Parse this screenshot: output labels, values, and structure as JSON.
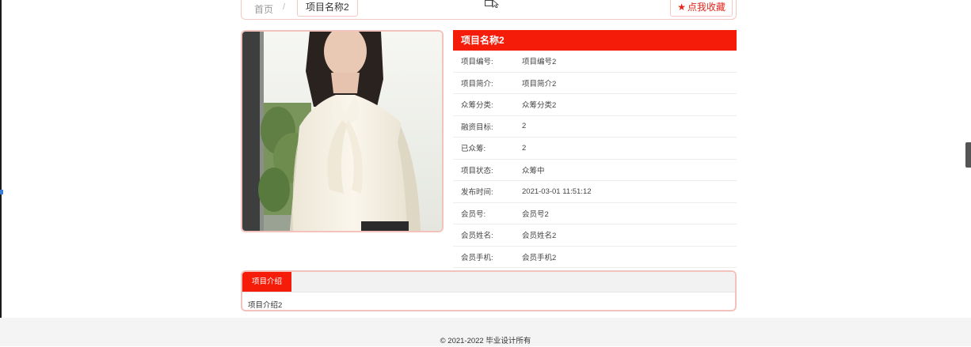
{
  "breadcrumb": {
    "home": "首页",
    "separator": "/",
    "current": "项目名称2"
  },
  "favorite_button": {
    "icon": "star-icon",
    "label": "点我收藏"
  },
  "project": {
    "title": "项目名称2",
    "fields": [
      {
        "label": "项目编号:",
        "value": "项目编号2"
      },
      {
        "label": "项目简介:",
        "value": "项目简介2"
      },
      {
        "label": "众筹分类:",
        "value": "众筹分类2"
      },
      {
        "label": "融资目标:",
        "value": "2"
      },
      {
        "label": "已众筹:",
        "value": "2"
      },
      {
        "label": "项目状态:",
        "value": "众筹中"
      },
      {
        "label": "发布时间:",
        "value": "2021-03-01 11:51:12"
      },
      {
        "label": "会员号:",
        "value": "会员号2"
      },
      {
        "label": "会员姓名:",
        "value": "会员姓名2"
      },
      {
        "label": "会员手机:",
        "value": "会员手机2"
      }
    ]
  },
  "intro": {
    "tab": "项目介绍",
    "content": "项目介绍2"
  },
  "footer": {
    "copyright": "© 2021-2022 毕业设计所有"
  },
  "colors": {
    "accent": "#f51d0a",
    "border": "#f4c2bd",
    "footer_bg": "#f4f4f4"
  }
}
